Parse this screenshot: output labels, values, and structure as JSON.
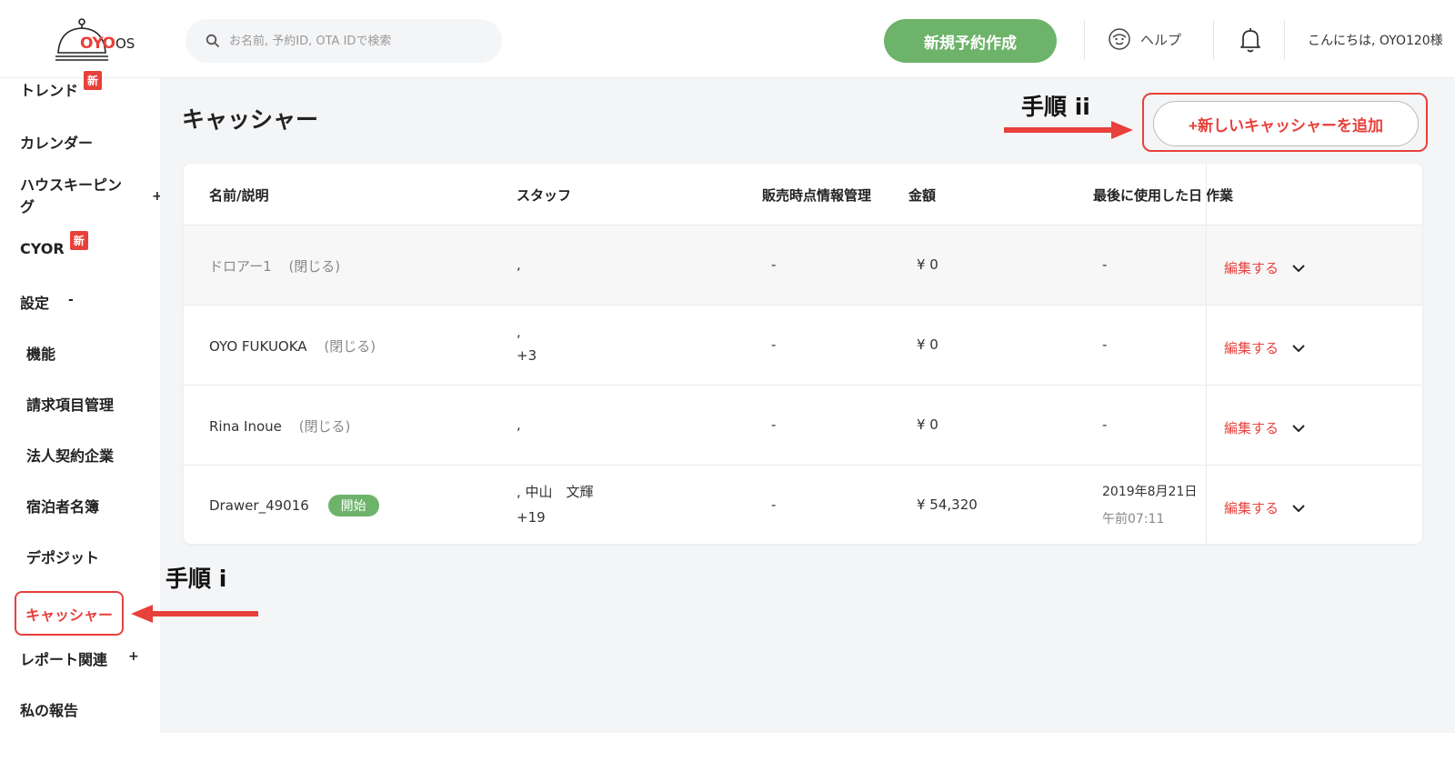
{
  "header": {
    "logo_text": "OYO",
    "logo_suffix": "OS",
    "search_placeholder": "お名前, 予約ID, OTA IDで検索",
    "new_booking_label": "新規予約作成",
    "help_label": "ヘルプ",
    "greeting": "こんにちは, OYO120様"
  },
  "sidebar": {
    "trend": "トレンド",
    "new_badge": "新",
    "calendar": "カレンダー",
    "housekeeping_line1": "ハウスキーピン",
    "housekeeping_line2": "グ",
    "cyor": "CYOR",
    "settings": "設定",
    "features": "機能",
    "billing": "請求項目管理",
    "corporate": "法人契約企業",
    "guest_list": "宿泊者名簿",
    "deposit": "デポジット",
    "cashier": "キャッシャー",
    "reports": "レポート関連",
    "my_reports": "私の報告",
    "plus": "+",
    "minus": "-"
  },
  "main": {
    "title": "キャッシャー",
    "add_button": "+新しいキャッシャーを追加",
    "columns": [
      "名前/説明",
      "スタッフ",
      "販売時点情報管理",
      "金額",
      "最後に使用した日",
      "作業"
    ],
    "rows": [
      {
        "name": "ドロアー1",
        "status": "(閉じる)",
        "staff1": ",",
        "staff2": "",
        "pos": "-",
        "amount": "¥ 0",
        "last_used1": "-",
        "last_used2": "",
        "action": "編集する"
      },
      {
        "name": "OYO FUKUOKA",
        "status": "(閉じる)",
        "staff1": ",",
        "staff2": "+3",
        "pos": "-",
        "amount": "¥ 0",
        "last_used1": "-",
        "last_used2": "",
        "action": "編集する"
      },
      {
        "name": "Rina Inoue",
        "status": "(閉じる)",
        "staff1": ",",
        "staff2": "",
        "pos": "-",
        "amount": "¥ 0",
        "last_used1": "-",
        "last_used2": "",
        "action": "編集する"
      },
      {
        "name": "Drawer_49016",
        "status": "開始",
        "staff1": ", 中山　文輝",
        "staff2": "+19",
        "pos": "-",
        "amount": "¥ 54,320",
        "last_used1": "2019年8月21日",
        "last_used2": "午前07:11",
        "action": "編集する"
      }
    ]
  },
  "annotations": {
    "step_i": "手順 i",
    "step_ii": "手順 ii"
  },
  "colors": {
    "accent_red": "#e8403b",
    "accent_green": "#6db36a"
  }
}
